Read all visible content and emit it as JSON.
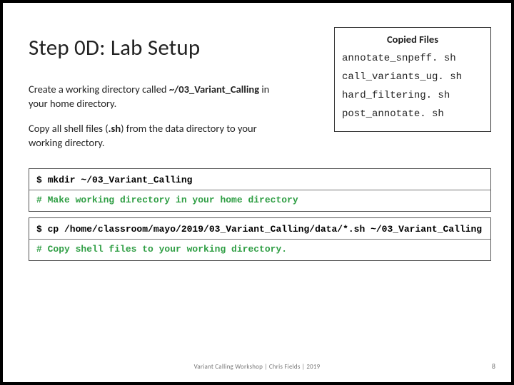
{
  "title": "Step 0D: Lab Setup",
  "paragraphs": {
    "p1_a": "Create a working directory called ",
    "p1_b": "~/03_Variant_Calling",
    "p1_c": " in your home directory.",
    "p2_a": "Copy all shell files (",
    "p2_b": ".sh",
    "p2_c": ") from the data directory to your working directory."
  },
  "filesbox": {
    "heading": "Copied Files",
    "items": [
      "annotate_snpeff. sh",
      "call_variants_ug. sh",
      "hard_filtering. sh",
      "post_annotate. sh"
    ]
  },
  "code1": {
    "cmd": "$ mkdir ~/03_Variant_Calling",
    "comment": "# Make working directory in your home directory"
  },
  "code2": {
    "cmd": "$ cp /home/classroom/mayo/2019/03_Variant_Calling/data/*.sh ~/03_Variant_Calling",
    "comment": "# Copy shell files to your working directory."
  },
  "footer": "Variant Calling Workshop | Chris Fields | 2019",
  "page": "8"
}
